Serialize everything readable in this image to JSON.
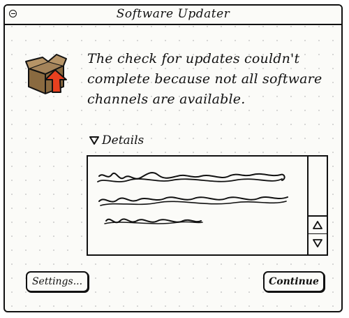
{
  "window": {
    "title": "Software Updater"
  },
  "message": {
    "line1": "The check for updates couldn't",
    "line2": "complete because not all software",
    "line3": "channels are available."
  },
  "details": {
    "label": "Details",
    "expanded": true,
    "content_note_lines": 3
  },
  "icons": {
    "window_close": "close-box-icon",
    "app": "package-with-up-arrow-icon",
    "disclosure": "triangle-down-icon",
    "scroll_up": "arrow-up-icon",
    "scroll_down": "arrow-down-icon"
  },
  "buttons": {
    "settings_label": "Settings...",
    "continue_label": "Continue"
  },
  "colors": {
    "arrow": "#e8401f",
    "box": "#8a6a40",
    "ink": "#111111"
  }
}
